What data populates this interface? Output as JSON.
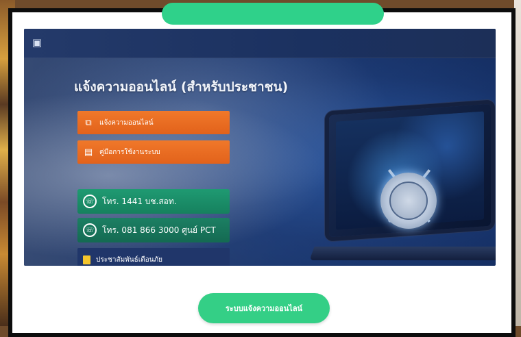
{
  "header": {
    "logo_icon": "police-badge-icon",
    "line1": "",
    "line2": ""
  },
  "hero": {
    "title": "แจ้งความออนไลน์ (สำหรับประชาชน)",
    "subtitle": ""
  },
  "buttons": {
    "report_online": {
      "label": "แจ้งความออนไลน์",
      "icon": "external-link-icon"
    },
    "user_manual": {
      "label": "คู่มือการใช้งานระบบ",
      "icon": "document-icon"
    }
  },
  "contact": {
    "section_label": "",
    "hotlines": [
      {
        "main": "โทร. 1441 บช.สอท.",
        "sub": "",
        "icon": "phone-icon"
      },
      {
        "main": "โทร. 081 866 3000 ศูนย์ PCT",
        "sub": "",
        "icon": "phone-icon"
      }
    ]
  },
  "notice": {
    "label": "ประชาสัมพันธ์เตือนภัย",
    "icon": "notice-icon"
  },
  "cta": {
    "label": "ระบบแจ้งความออนไลน์"
  },
  "colors": {
    "cta_green": "#34cf86",
    "orange": "#e2621b",
    "hotline_green": "#16815e",
    "navy": "#20366a",
    "hero_blue": "#18366f"
  }
}
